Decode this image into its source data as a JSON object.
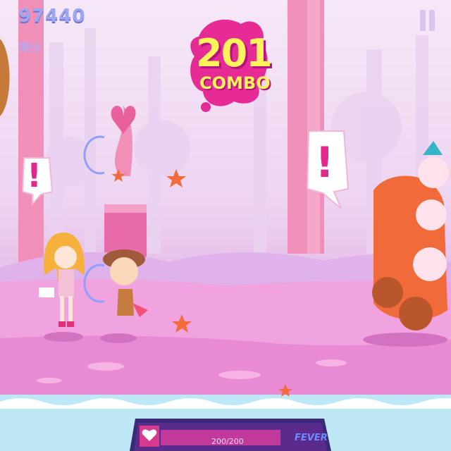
{
  "hud": {
    "score": "97440",
    "score_label": "得分",
    "pause_icon": "pause-icon"
  },
  "combo": {
    "count": "201",
    "label": "COMBO"
  },
  "alerts": {
    "left": "!",
    "right": "!"
  },
  "fever": {
    "count": "200/200",
    "label": "FEVER",
    "fill_fraction": 1.0,
    "icon": "heart-icon"
  },
  "colors": {
    "combo_text": "#fff25a",
    "combo_splash": "#e62a96",
    "score_text": "#9fa6f0",
    "ground": "#ec8fd6",
    "fever_bar": "#c13a9b"
  }
}
